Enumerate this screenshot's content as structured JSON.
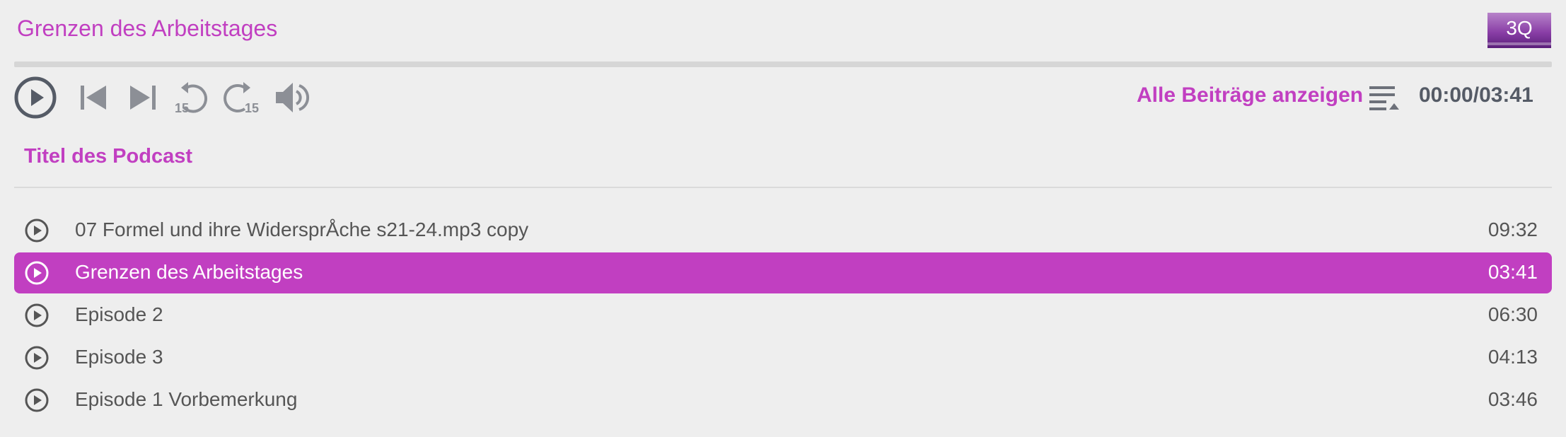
{
  "player": {
    "episode_title": "Grenzen des Arbeitstages",
    "logo_text": "3Q",
    "progress_fraction": 0.0,
    "all_posts_label": "Alle Beiträge anzeigen",
    "time_display": "00:00/03:41",
    "skip_back_seconds": "15",
    "skip_forward_seconds": "15",
    "podcast_title": "Titel des Podcast",
    "accent_color": "#c13fc1",
    "icon_color": "#555b66",
    "icons": {
      "play": "play-circle-icon",
      "previous": "skip-previous-icon",
      "next": "skip-next-icon",
      "rewind": "rewind-15-icon",
      "forward": "forward-15-icon",
      "volume": "volume-icon",
      "playlist": "playlist-icon"
    }
  },
  "playlist": [
    {
      "title": "07 Formel und ihre WidersprÅche s21-24.mp3 copy",
      "duration": "09:32",
      "active": false
    },
    {
      "title": "Grenzen des Arbeitstages",
      "duration": "03:41",
      "active": true
    },
    {
      "title": "Episode 2",
      "duration": "06:30",
      "active": false
    },
    {
      "title": "Episode 3",
      "duration": "04:13",
      "active": false
    },
    {
      "title": "Episode 1 Vorbemerkung",
      "duration": "03:46",
      "active": false
    }
  ]
}
